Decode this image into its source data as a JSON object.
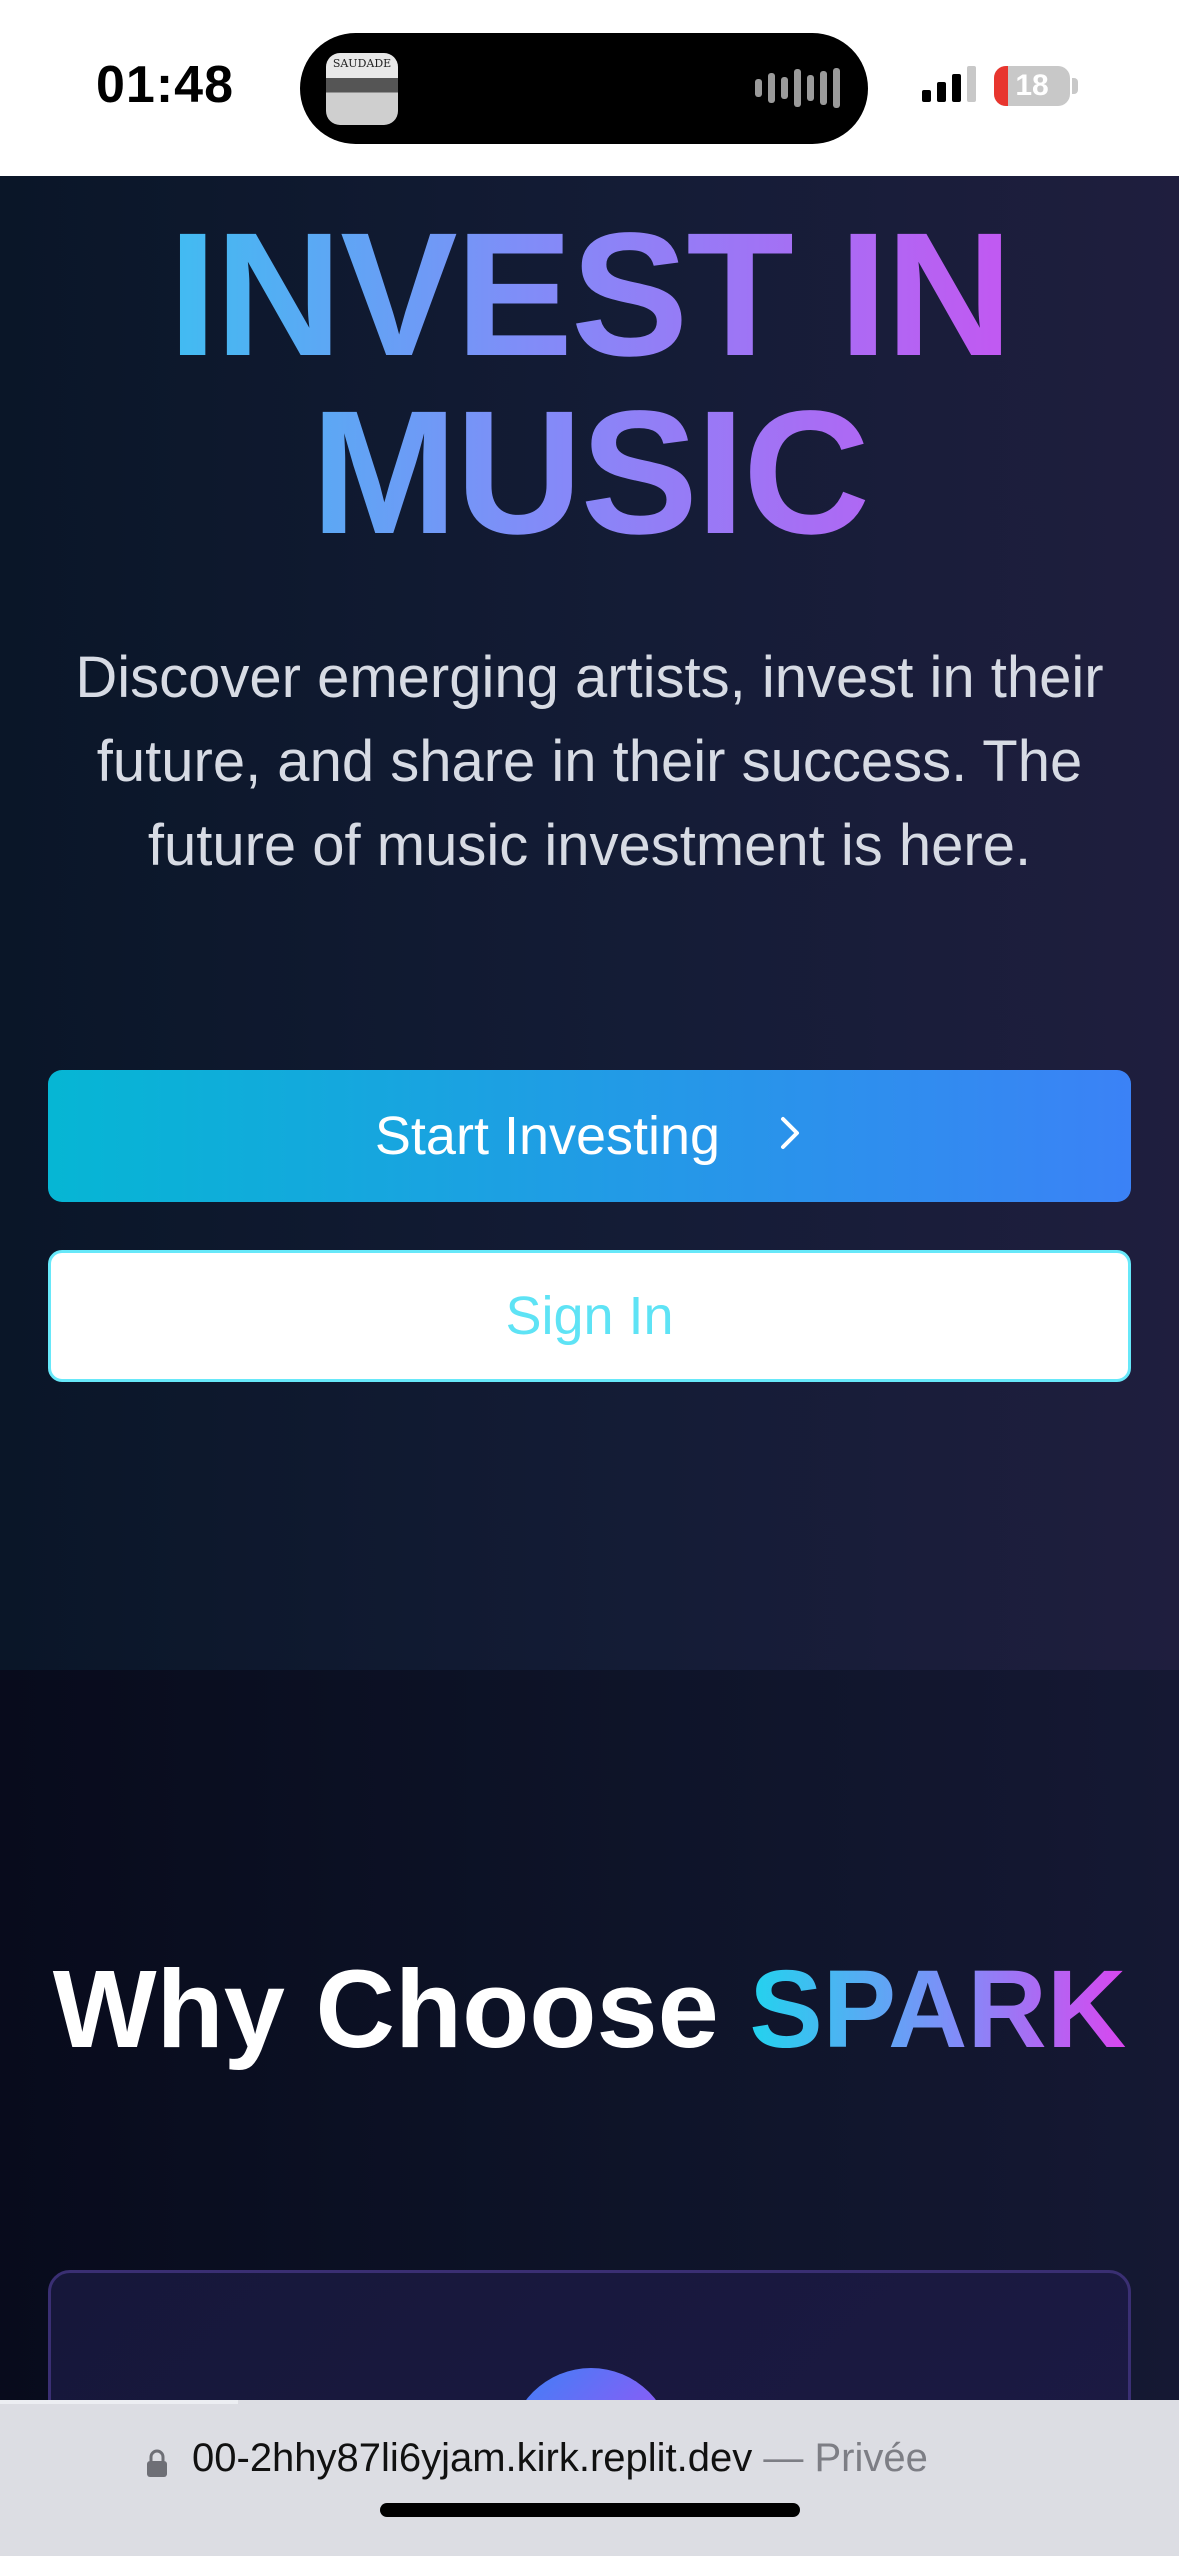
{
  "status_bar": {
    "time": "01:48",
    "battery_percent": "18",
    "battery_level": 0.18,
    "signal_bars": 3,
    "island_art_text": "SAUDADE"
  },
  "hero": {
    "title_line1": "INVEST IN",
    "title_line2": "MUSIC",
    "description": "Discover emerging artists, invest in their future, and share in their success. The future of music investment is here.",
    "primary_button": {
      "label": "Start Investing",
      "icon": "chevron-right-icon"
    },
    "secondary_button": {
      "label": "Sign In"
    }
  },
  "features": {
    "title_prefix": "Why Choose",
    "title_brand": "SPARK"
  },
  "browser": {
    "url": "00-2hhy87li6yjam.kirk.replit.dev",
    "separator": " — ",
    "mode": "Privée",
    "lock_icon": "lock-icon"
  },
  "colors": {
    "accent_cyan": "#22d3ee",
    "accent_purple": "#d946ef",
    "accent_blue": "#3b82f6",
    "battery_low": "#e8352e"
  }
}
